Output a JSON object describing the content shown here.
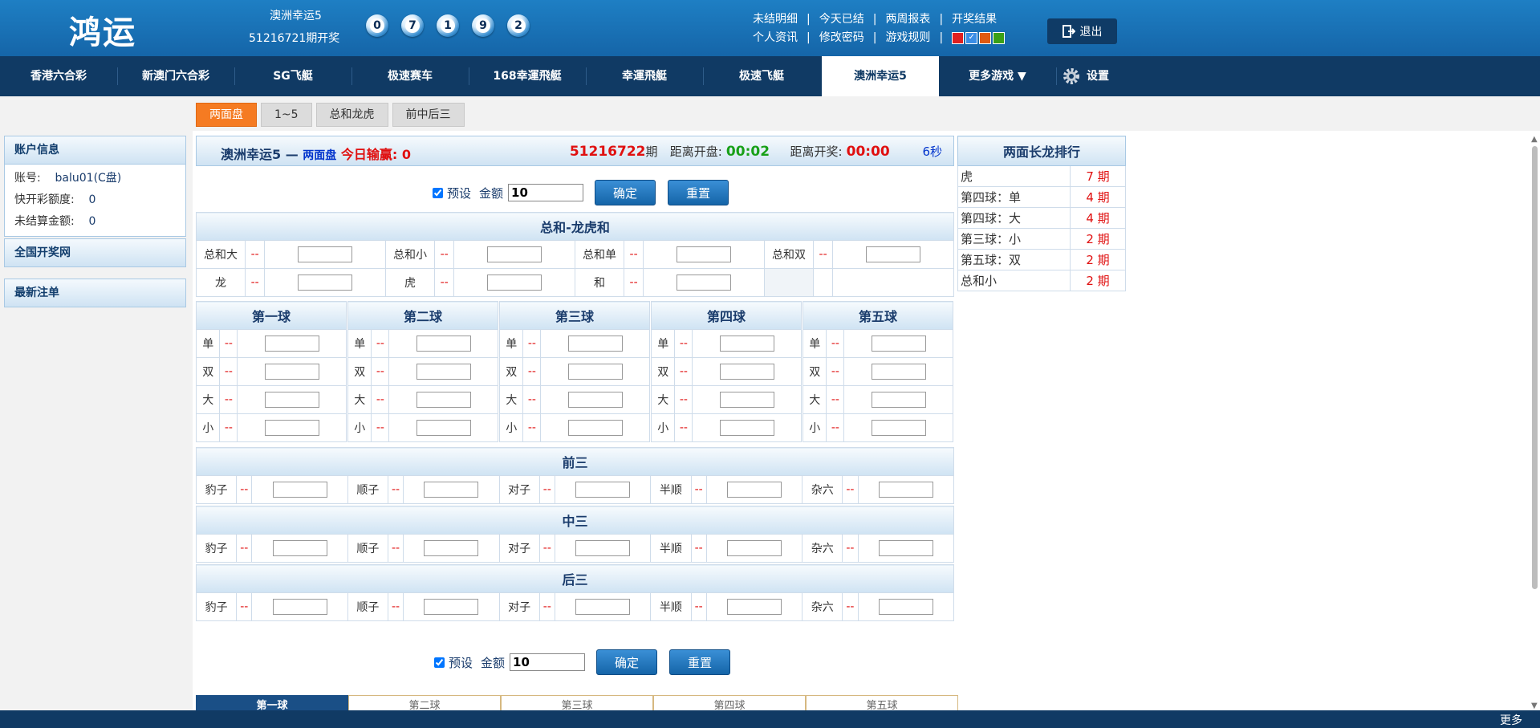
{
  "header": {
    "logo": "鸿运",
    "draw_name": "澳洲幸运5",
    "draw_issue": "51216721期开奖",
    "balls": [
      "0",
      "7",
      "1",
      "9",
      "2"
    ],
    "links_row1": [
      "未结明细",
      "今天已结",
      "两周报表",
      "开奖结果"
    ],
    "links_row2": [
      "个人资讯",
      "修改密码",
      "游戏规则"
    ],
    "theme_colors": [
      "#e02020",
      "#3a8ee6",
      "#e05a10",
      "#3aa017"
    ],
    "logout_label": "退出"
  },
  "nav": {
    "items": [
      "香港六合彩",
      "新澳门六合彩",
      "SG飞艇",
      "极速赛车",
      "168幸運飛艇",
      "幸運飛艇",
      "极速飞艇",
      "澳洲幸运5",
      "更多游戏 ▼"
    ],
    "active": "澳洲幸运5",
    "settings_label": "设置"
  },
  "subtabs": [
    "两面盘",
    "1~5",
    "总和龙虎",
    "前中后三"
  ],
  "sidebar": {
    "account_title": "账户信息",
    "account_label": "账号:",
    "account_value": "balu01(C盘)",
    "quota_label": "快开彩额度:",
    "quota_value": "0",
    "unsettled_label": "未结算金额:",
    "unsettled_value": "0",
    "national_title": "全国开奖网",
    "latest_title": "最新注单"
  },
  "main": {
    "game_title": "澳洲幸运5 —",
    "mode": "两面盘",
    "today_label": "今日输赢:",
    "today_value": "0",
    "issue": "51216722",
    "issue_suffix": "期",
    "close_label": "距离开盘:",
    "close_time": "00:02",
    "draw_label": "距离开奖:",
    "draw_time": "00:00",
    "countdown": "6秒"
  },
  "controls": {
    "preset_label": "预设",
    "amount_label": "金额",
    "amount_value": "10",
    "confirm": "确定",
    "reset": "重置"
  },
  "sum_section": {
    "title": "总和-龙虎和",
    "row1": [
      "总和大",
      "总和小",
      "总和单",
      "总和双"
    ],
    "row2": [
      "龙",
      "虎",
      "和"
    ]
  },
  "balls_section": {
    "titles": [
      "第一球",
      "第二球",
      "第三球",
      "第四球",
      "第五球"
    ],
    "rows": [
      "单",
      "双",
      "大",
      "小"
    ]
  },
  "three_sections": [
    {
      "title": "前三",
      "items": [
        "豹子",
        "顺子",
        "对子",
        "半顺",
        "杂六"
      ]
    },
    {
      "title": "中三",
      "items": [
        "豹子",
        "顺子",
        "对子",
        "半顺",
        "杂六"
      ]
    },
    {
      "title": "后三",
      "items": [
        "豹子",
        "顺子",
        "对子",
        "半顺",
        "杂六"
      ]
    }
  ],
  "odds_placeholder": "--",
  "dragon": {
    "title": "两面长龙排行",
    "rows": [
      {
        "name": "虎",
        "count": "7 期"
      },
      {
        "name": "第四球：单",
        "count": "4 期"
      },
      {
        "name": "第四球：大",
        "count": "4 期"
      },
      {
        "name": "第三球：小",
        "count": "2 期"
      },
      {
        "name": "第五球：双",
        "count": "2 期"
      },
      {
        "name": "总和小",
        "count": "2 期"
      }
    ]
  },
  "bottom_tabs": [
    "第一球",
    "第二球",
    "第三球",
    "第四球",
    "第五球"
  ],
  "footer": {
    "more": "更多"
  }
}
